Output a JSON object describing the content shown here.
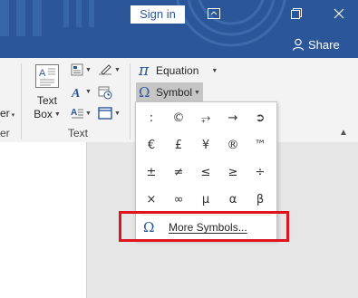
{
  "titlebar": {
    "signin_label": "Sign in",
    "share_label": "Share",
    "colors": {
      "bar": "#2b579a",
      "accent": "#e0141e"
    }
  },
  "ribbon": {
    "left_cut_label": "er",
    "left_cut_caret": "▾",
    "left_cut_group": "er",
    "textbox_label_line1": "Text",
    "textbox_label_line2": "Box",
    "text_group_label": "Text",
    "equation_label": "Equation",
    "symbol_label": "Symbol",
    "pi_glyph": "π",
    "omega_glyph": "Ω"
  },
  "symbol_menu": {
    "symbols": [
      ":",
      "©",
      "⥅",
      "→",
      "➲",
      "€",
      "£",
      "¥",
      "®",
      "™",
      "±",
      "≠",
      "≤",
      "≥",
      "÷",
      "×",
      "∞",
      "µ",
      "α",
      "β"
    ],
    "more_symbols_label": "More Symbols...",
    "more_symbols_glyph": "Ω"
  },
  "icons": {
    "restore": "restore-icon",
    "maximize": "maximize-icon",
    "close": "close-icon",
    "share": "person-icon"
  }
}
